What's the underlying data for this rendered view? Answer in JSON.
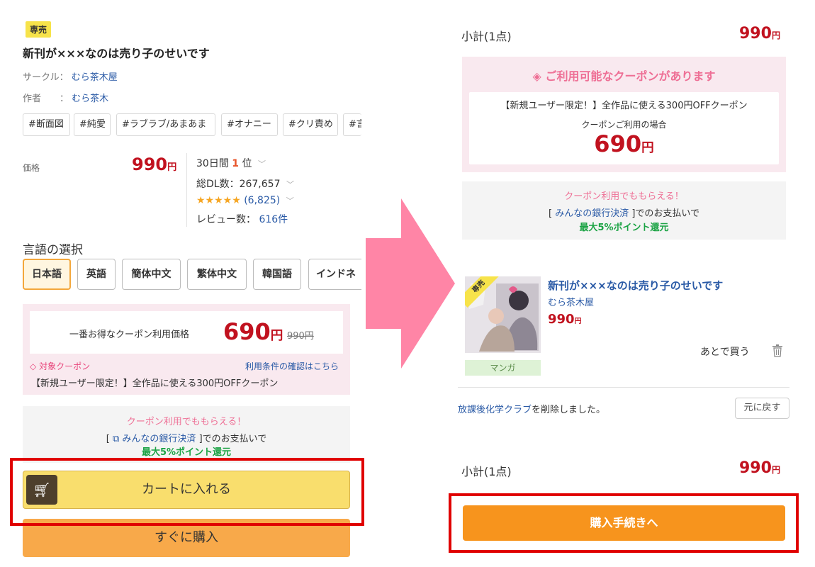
{
  "left": {
    "badge": "専売",
    "title": "新刊が×××なのは売り子のせいです",
    "circle_label": "サークル：",
    "circle_value": "むら茶木屋",
    "author_label": "作者　　：",
    "author_value": "むら茶木",
    "tags": [
      "#断面図",
      "#純愛",
      "#ラブラブ/あまあま",
      "#オナニー",
      "#クリ責め",
      "#言"
    ],
    "price_label": "価格",
    "price": "990",
    "yen": "円",
    "rank_prefix": "30日間",
    "rank_num": "1",
    "rank_suffix": "位",
    "dl": "総DL数：267,657",
    "stars": "★★★★★",
    "rating_count": "(6,825)",
    "review_label": "レビュー数：",
    "review_count": "616件",
    "lang_title": "言語の選択",
    "langs": [
      "日本語",
      "英語",
      "簡体中文",
      "繁体中文",
      "韓国語",
      "インドネ"
    ],
    "coupon_price_label": "一番お得なクーポン利用価格",
    "coupon_price": "690",
    "orig_price": "990円",
    "coupon_tag": "対象クーポン",
    "coupon_terms": "利用条件の確認はこちら",
    "coupon_desc": "【新規ユーザー限定！】全作品に使える300円OFFクーポン",
    "bank_headline": "クーポン利用でももらえる！",
    "bank_pre": "[",
    "bank_name": "みんなの銀行決済",
    "bank_post": "]でのお支払いで",
    "bank_points": "最大5%ポイント還元",
    "cart_button": "カートに入れる",
    "buy_button": "すぐに購入"
  },
  "right": {
    "subtotal_label": "小計(1点)",
    "subtotal_price": "990",
    "yen": "円",
    "coupon_available": "ご利用可能なクーポンがあります",
    "coupon_desc": "【新規ユーザー限定！】全作品に使える300円OFFクーポン",
    "coupon_case": "クーポンご利用の場合",
    "coupon_price": "690",
    "bank_headline": "クーポン利用でももらえる！",
    "bank_pre": "[",
    "bank_name": "みんなの銀行決済",
    "bank_post": "]でのお支払いで",
    "bank_points": "最大5%ポイント還元",
    "item_badge": "専売",
    "item_title": "新刊が×××なのは売り子のせいです",
    "item_circle": "むら茶木屋",
    "item_price": "990",
    "item_category": "マンガ",
    "later_buy": "あとで買う",
    "removed_name": "放課後化学クラブ",
    "removed_msg": "を削除しました。",
    "undo_button": "元に戻す",
    "subtotal2_label": "小計(1点)",
    "subtotal2_price": "990",
    "checkout_button": "購入手続きへ"
  },
  "colors": {
    "accent_red": "#c1121f",
    "link_blue": "#2a5aa6",
    "orange": "#f7941d",
    "pink": "#f7e8ee",
    "arrow_pink": "#ff85a6",
    "highlight_red": "#e00000"
  }
}
